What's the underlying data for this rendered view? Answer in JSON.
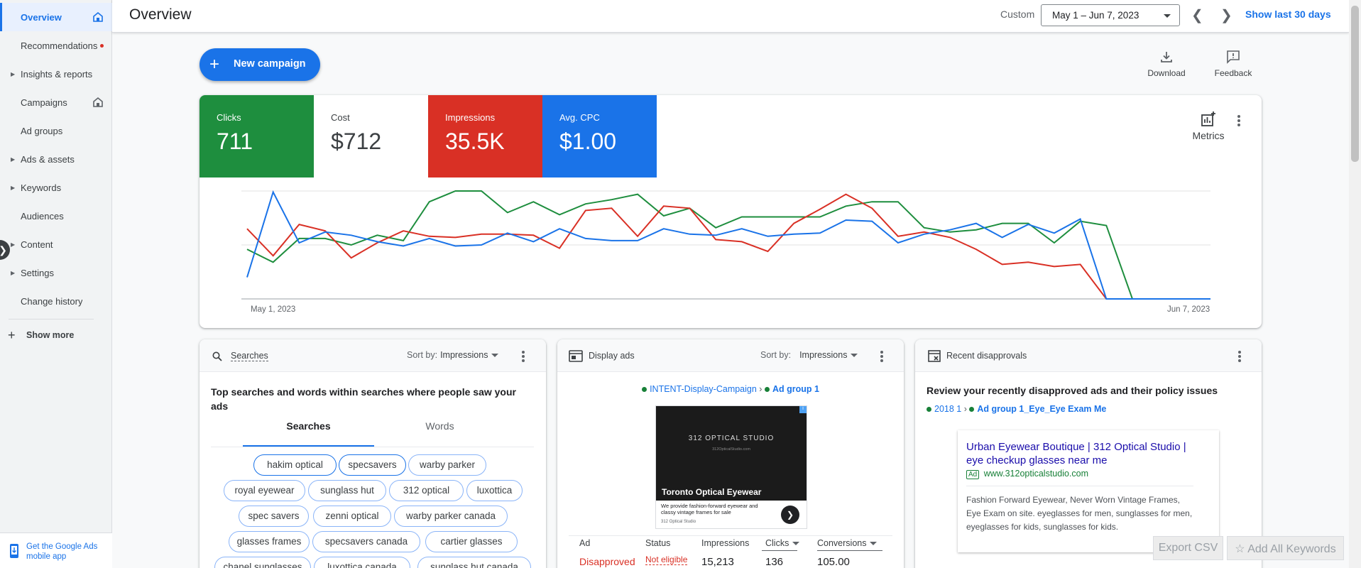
{
  "sidebar": {
    "items": [
      {
        "label": "Overview"
      },
      {
        "label": "Recommendations"
      },
      {
        "label": "Insights & reports"
      },
      {
        "label": "Campaigns"
      },
      {
        "label": "Ad groups"
      },
      {
        "label": "Ads & assets"
      },
      {
        "label": "Keywords"
      },
      {
        "label": "Audiences"
      },
      {
        "label": "Content"
      },
      {
        "label": "Settings"
      },
      {
        "label": "Change history"
      }
    ],
    "show_more": "Show more",
    "mobile_app": "Get the Google Ads mobile app"
  },
  "header": {
    "title": "Overview",
    "custom_label": "Custom",
    "date_range": "May 1 – Jun 7, 2023",
    "show_last": "Show last 30 days"
  },
  "toolbar": {
    "new_campaign": "New campaign",
    "download": "Download",
    "feedback": "Feedback"
  },
  "metrics": [
    {
      "label": "Clicks",
      "value": "711",
      "color": "#1e8e3e"
    },
    {
      "label": "Cost",
      "value": "$712",
      "color": "#ffffff"
    },
    {
      "label": "Impressions",
      "value": "35.5K",
      "color": "#d93025"
    },
    {
      "label": "Avg. CPC",
      "value": "$1.00",
      "color": "#1a73e8"
    }
  ],
  "metrics_button": "Metrics",
  "chart_data": {
    "type": "line",
    "x_start": "May 1, 2023",
    "x_end": "Jun 7, 2023",
    "series": [
      {
        "color": "#1e8e3e",
        "values": [
          0.46,
          0.34,
          0.56,
          0.56,
          0.5,
          0.59,
          0.54,
          0.9,
          1.0,
          1.0,
          0.8,
          0.9,
          0.78,
          0.88,
          0.92,
          0.97,
          0.77,
          0.84,
          0.66,
          0.76,
          0.76,
          0.76,
          0.76,
          0.86,
          0.9,
          0.9,
          0.66,
          0.62,
          0.64,
          0.7,
          0.7,
          0.52,
          0.72,
          0.68,
          0.0,
          0.0,
          0.0,
          0.0
        ]
      },
      {
        "color": "#d93025",
        "values": [
          0.65,
          0.4,
          0.69,
          0.63,
          0.38,
          0.52,
          0.63,
          0.58,
          0.57,
          0.6,
          0.6,
          0.59,
          0.47,
          0.82,
          0.84,
          0.58,
          0.86,
          0.84,
          0.55,
          0.53,
          0.44,
          0.7,
          0.83,
          0.97,
          0.84,
          0.58,
          0.62,
          0.57,
          0.46,
          0.32,
          0.34,
          0.3,
          0.32,
          0.0,
          0.0,
          0.0,
          0.0,
          0.0
        ]
      },
      {
        "color": "#1a73e8",
        "values": [
          0.2,
          0.99,
          0.52,
          0.62,
          0.59,
          0.53,
          0.49,
          0.56,
          0.49,
          0.5,
          0.61,
          0.53,
          0.65,
          0.56,
          0.54,
          0.54,
          0.65,
          0.6,
          0.59,
          0.65,
          0.58,
          0.6,
          0.61,
          0.73,
          0.72,
          0.52,
          0.6,
          0.64,
          0.7,
          0.57,
          0.69,
          0.61,
          0.74,
          0.0,
          0.0,
          0.0,
          0.0,
          0.0
        ]
      }
    ]
  },
  "searches_card": {
    "title": "Searches",
    "sort_label": "Sort by:",
    "sort_value": "Impressions",
    "description": "Top searches and words within searches where people saw your ads",
    "tab_searches": "Searches",
    "tab_words": "Words",
    "chips": [
      "hakim optical",
      "specsavers",
      "warby parker",
      "royal eyewear",
      "sunglass hut",
      "312 optical",
      "luxottica",
      "spec savers",
      "zenni optical",
      "warby parker canada",
      "glasses frames",
      "specsavers canada",
      "cartier glasses",
      "chanel sunglasses",
      "luxottica canada",
      "sunglass hut canada"
    ]
  },
  "display_card": {
    "title": "Display ads",
    "sort_label": "Sort by:",
    "sort_value": "Impressions",
    "campaign": "INTENT-Display-Campaign",
    "ad_group": "Ad group 1",
    "ad_brand": "312 OPTICAL STUDIO",
    "ad_site": "312OpticalStudio.com",
    "ad_headline": "Toronto Optical Eyewear",
    "ad_desc": "We provide fashion-forward eyewear and classy vintage frames for sale",
    "ad_small": "312 Optical Studio",
    "table_headers": [
      "Ad",
      "Status",
      "Impressions",
      "Clicks",
      "Conversions"
    ],
    "row": {
      "ad": "Disapproved",
      "status": "Not eligible",
      "impressions": "15,213",
      "clicks": "136",
      "conversions": "105.00"
    }
  },
  "disapprovals_card": {
    "title": "Recent disapprovals",
    "description": "Review your recently disapproved ads and their policy issues",
    "campaign": "2018 1",
    "ad_group": "Ad group 1_Eye_Eye Exam Me",
    "ad_title": "Urban Eyewear Boutique | 312 Optical Studio | eye checkup glasses near me",
    "ad_badge": "Ad",
    "ad_url": "www.312opticalstudio.com",
    "ad_desc": "Fashion Forward Eyewear, Never Worn Vintage Frames, Eye Exam on site. eyeglasses for men, sunglasses for men, eyeglasses for kids, sunglasses for kids."
  },
  "footer_buttons": {
    "export_csv": "Export CSV",
    "add_keywords": "Add All Keywords"
  }
}
